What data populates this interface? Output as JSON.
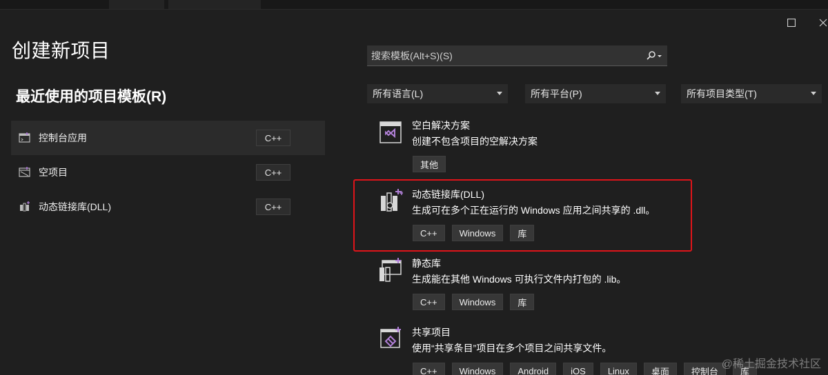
{
  "page_title": "创建新项目",
  "recent": {
    "title": "最近使用的项目模板(R)",
    "items": [
      {
        "label": "控制台应用",
        "tag": "C++",
        "icon": "console-app-icon"
      },
      {
        "label": "空项目",
        "tag": "C++",
        "icon": "empty-project-icon"
      },
      {
        "label": "动态链接库(DLL)",
        "tag": "C++",
        "icon": "dll-library-icon"
      }
    ]
  },
  "search": {
    "placeholder": "搜索模板(Alt+S)(S)",
    "icon": "search-icon"
  },
  "filters": {
    "language": "所有语言(L)",
    "platform": "所有平台(P)",
    "project_type": "所有项目类型(T)"
  },
  "templates": [
    {
      "name": "空白解决方案",
      "desc": "创建不包含项目的空解决方案",
      "tags": [
        "其他"
      ],
      "icon": "visual-studio-icon"
    },
    {
      "name": "动态链接库(DLL)",
      "desc": "生成可在多个正在运行的 Windows 应用之间共享的 .dll。",
      "tags": [
        "C++",
        "Windows",
        "库"
      ],
      "icon": "dll-library-icon"
    },
    {
      "name": "静态库",
      "desc": "生成能在其他 Windows 可执行文件内打包的 .lib。",
      "tags": [
        "C++",
        "Windows",
        "库"
      ],
      "icon": "static-library-icon"
    },
    {
      "name": "共享项目",
      "desc": "使用“共享条目”项目在多个项目之间共享文件。",
      "tags": [
        "C++",
        "Windows",
        "Android",
        "iOS",
        "Linux",
        "桌面",
        "控制台",
        "库"
      ],
      "icon": "shared-project-icon"
    }
  ],
  "watermark": "@稀土掘金技术社区",
  "colors": {
    "background": "#1f1f1f",
    "highlight": "#e0141a",
    "accent": "#b180d7"
  }
}
